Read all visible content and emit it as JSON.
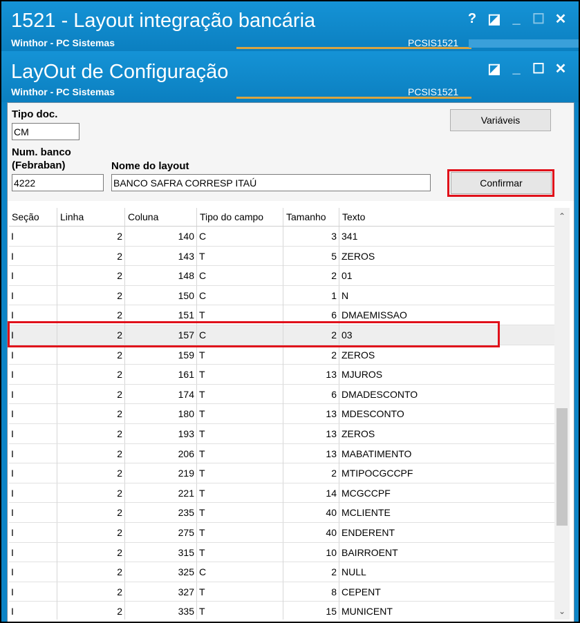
{
  "window1": {
    "title": "1521 - Layout integração bancária",
    "subtitle": "Winthor - PC Sistemas",
    "code": "PCSIS1521",
    "buttons": [
      "?",
      "◪",
      "_",
      "☐",
      "✕"
    ]
  },
  "window2": {
    "title": "LayOut de Configuração",
    "subtitle": "Winthor - PC Sistemas",
    "code": "PCSIS1521",
    "buttons": [
      "◪",
      "_",
      "☐",
      "✕"
    ]
  },
  "form": {
    "tipo_doc_label": "Tipo doc.",
    "tipo_doc_value": "CM",
    "num_banco_label_1": "Num. banco",
    "num_banco_label_2": "(Febraban)",
    "num_banco_value": "4222",
    "nome_layout_label": "Nome do layout",
    "nome_layout_value": "BANCO SAFRA CORRESP ITAÚ",
    "variaveis_button": "Variáveis",
    "confirmar_button": "Confirmar"
  },
  "grid": {
    "columns": [
      "Seção",
      "Linha",
      "Coluna",
      "Tipo do campo",
      "Tamanho",
      "Texto"
    ],
    "selected_row": 5,
    "rows": [
      [
        "I",
        "2",
        "140",
        "C",
        "3",
        "341"
      ],
      [
        "I",
        "2",
        "143",
        "T",
        "5",
        "ZEROS"
      ],
      [
        "I",
        "2",
        "148",
        "C",
        "2",
        "01"
      ],
      [
        "I",
        "2",
        "150",
        "C",
        "1",
        "N"
      ],
      [
        "I",
        "2",
        "151",
        "T",
        "6",
        "DMAEMISSAO"
      ],
      [
        "I",
        "2",
        "157",
        "C",
        "2",
        "03"
      ],
      [
        "I",
        "2",
        "159",
        "T",
        "2",
        "ZEROS"
      ],
      [
        "I",
        "2",
        "161",
        "T",
        "13",
        "MJUROS"
      ],
      [
        "I",
        "2",
        "174",
        "T",
        "6",
        "DMADESCONTO"
      ],
      [
        "I",
        "2",
        "180",
        "T",
        "13",
        "MDESCONTO"
      ],
      [
        "I",
        "2",
        "193",
        "T",
        "13",
        "ZEROS"
      ],
      [
        "I",
        "2",
        "206",
        "T",
        "13",
        "MABATIMENTO"
      ],
      [
        "I",
        "2",
        "219",
        "T",
        "2",
        "MTIPOCGCCPF"
      ],
      [
        "I",
        "2",
        "221",
        "T",
        "14",
        "MCGCCPF"
      ],
      [
        "I",
        "2",
        "235",
        "T",
        "40",
        "MCLIENTE"
      ],
      [
        "I",
        "2",
        "275",
        "T",
        "40",
        "ENDERENT"
      ],
      [
        "I",
        "2",
        "315",
        "T",
        "10",
        "BAIRROENT"
      ],
      [
        "I",
        "2",
        "325",
        "C",
        "2",
        "NULL"
      ],
      [
        "I",
        "2",
        "327",
        "T",
        "8",
        "CEPENT"
      ],
      [
        "I",
        "2",
        "335",
        "T",
        "15",
        "MUNICENT"
      ]
    ]
  },
  "scrollbar": {
    "up": "⌃",
    "down": "⌄"
  }
}
